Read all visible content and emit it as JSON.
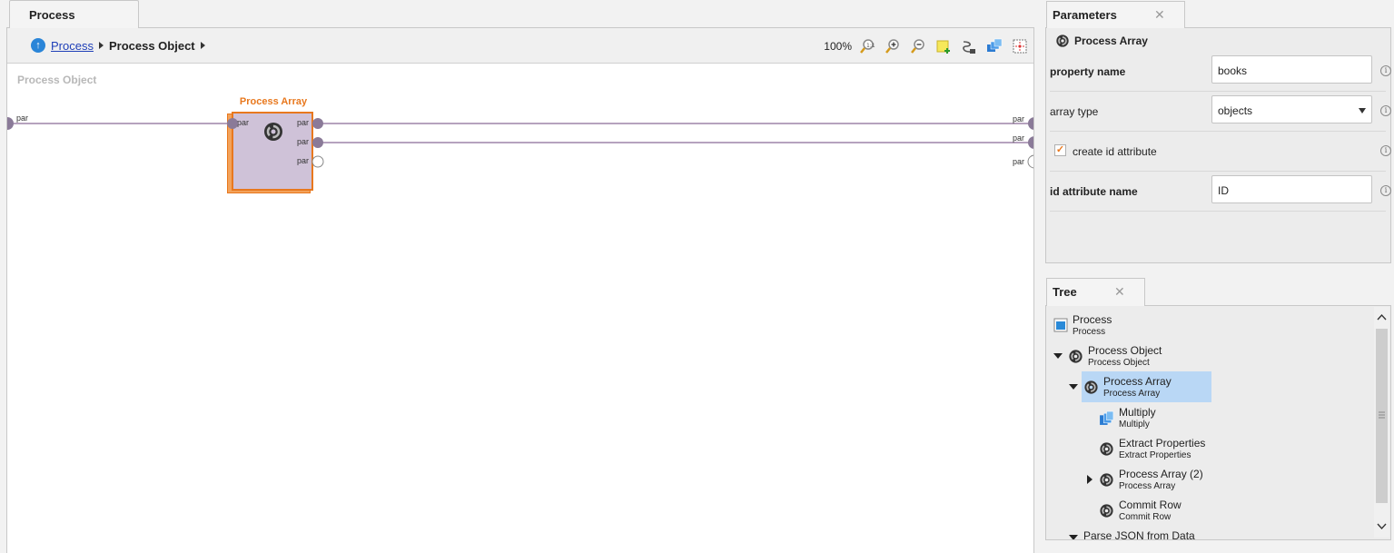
{
  "process_tab": {
    "label": "Process"
  },
  "breadcrumb": {
    "link": "Process",
    "current": "Process Object"
  },
  "toolbar": {
    "zoom": "100%"
  },
  "canvas": {
    "title": "Process Object",
    "operator": {
      "title": "Process Array"
    },
    "ports": {
      "in_left": "par",
      "op_in": "par",
      "op_out1": "par",
      "op_out2": "par",
      "op_out3": "par",
      "right1": "par",
      "right2": "par",
      "right3": "par"
    }
  },
  "parameters": {
    "tab_label": "Parameters",
    "header": "Process Array",
    "rows": [
      {
        "label": "property name",
        "value": "books"
      },
      {
        "label": "array type",
        "value": "objects"
      },
      {
        "label": "create id attribute",
        "checked": true
      },
      {
        "label": "id attribute name",
        "value": "ID"
      }
    ]
  },
  "tree": {
    "tab_label": "Tree",
    "items": [
      {
        "name": "Process",
        "sub": "Process",
        "icon": "process-icon"
      },
      {
        "name": "Process Object",
        "sub": "Process Object",
        "icon": "operator-ring-icon"
      },
      {
        "name": "Process Array",
        "sub": "Process Array",
        "icon": "operator-ring-icon"
      },
      {
        "name": "Multiply",
        "sub": "Multiply",
        "icon": "multiply-icon"
      },
      {
        "name": "Extract Properties",
        "sub": "Extract Properties",
        "icon": "operator-ring-icon"
      },
      {
        "name": "Process Array (2)",
        "sub": "Process Array",
        "icon": "operator-ring-icon"
      },
      {
        "name": "Commit Row",
        "sub": "Commit Row",
        "icon": "operator-ring-icon"
      },
      {
        "name": "Parse JSON from Data",
        "sub": "",
        "icon": "operator-ring-icon"
      }
    ]
  },
  "colors": {
    "accent": "#e8781e",
    "operator_fill": "#cfc2d8",
    "connection": "#8a6a98",
    "selection": "#b9d7f5"
  }
}
